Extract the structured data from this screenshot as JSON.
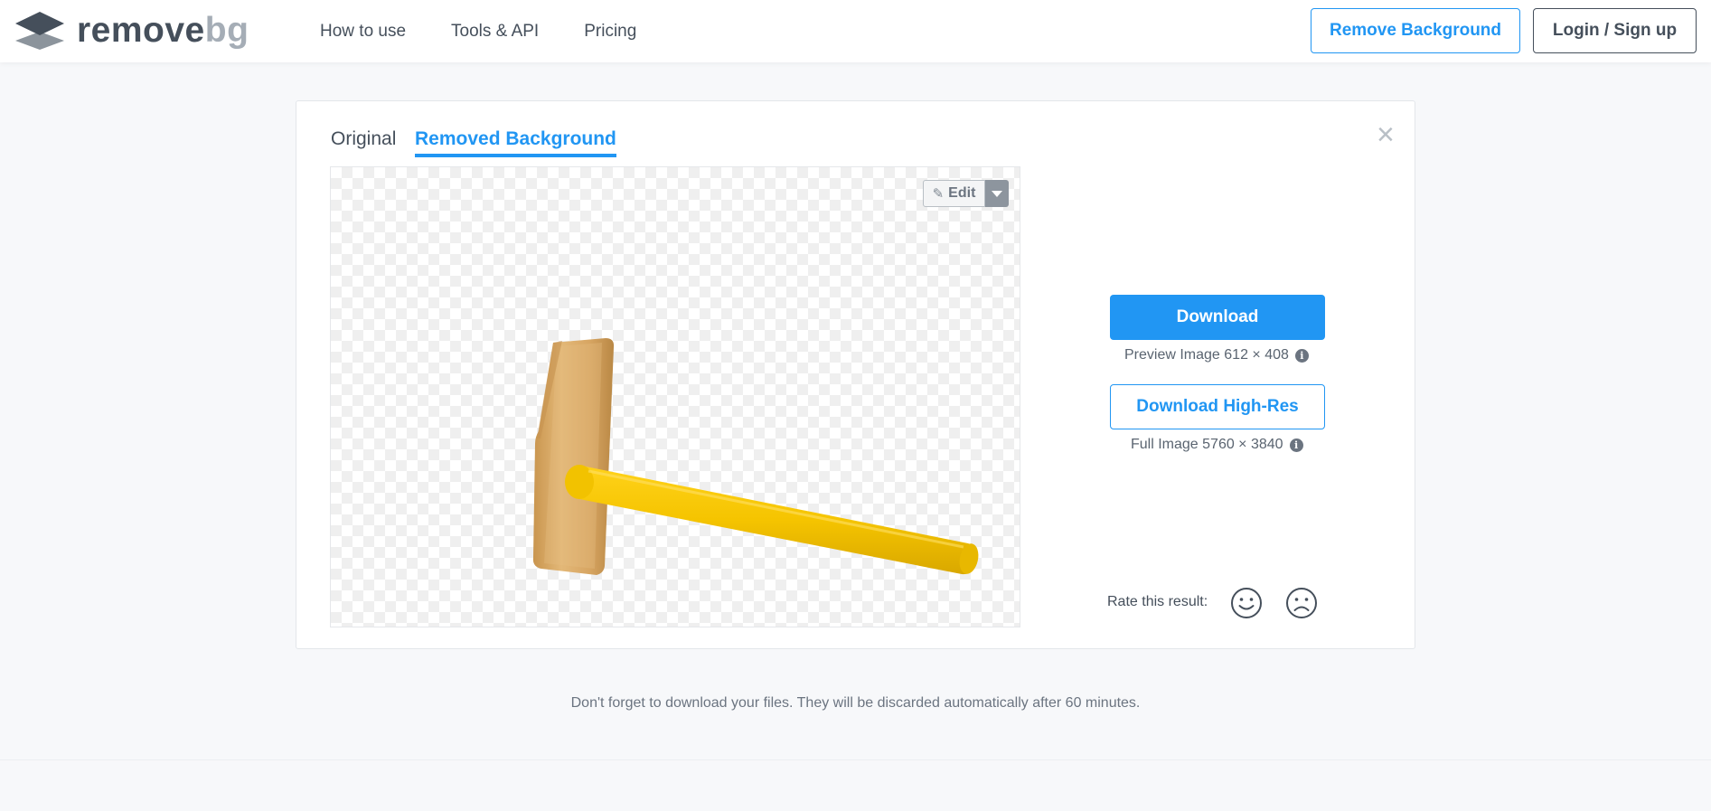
{
  "header": {
    "logo": {
      "word_main": "remove",
      "word_accent": "bg",
      "icon": "layers-logo-icon"
    },
    "nav": [
      {
        "label": "How to use"
      },
      {
        "label": "Tools & API"
      },
      {
        "label": "Pricing"
      }
    ],
    "remove_background_label": "Remove Background",
    "login_label": "Login / Sign up"
  },
  "card": {
    "tabs": [
      {
        "label": "Original",
        "active": false
      },
      {
        "label": "Removed Background",
        "active": true
      }
    ],
    "close_icon": "close-icon",
    "edit_label": "Edit",
    "download_label": "Download",
    "preview_info": "Preview Image 612 × 408",
    "hires_label": "Download High-Res",
    "full_info": "Full Image 5760 × 3840",
    "rate_label": "Rate this result:"
  },
  "footer": {
    "note": "Don't forget to download your files. They will be discarded automatically after 60 minutes."
  },
  "colors": {
    "accent": "#2196f3",
    "text": "#454f5b",
    "logo_accent": "#a5adb6",
    "background": "#f7f8fa"
  }
}
